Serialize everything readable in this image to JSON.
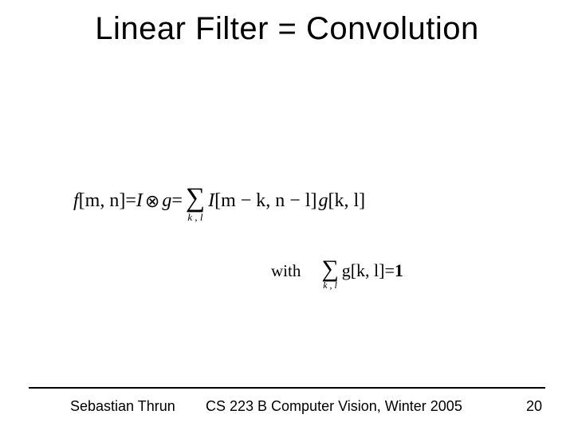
{
  "title": "Linear Filter = Convolution",
  "equation_main": {
    "lhs_f": "f",
    "lhs_args": "[m, n]",
    "eq1": " = ",
    "I": "I",
    "otimes": "⊗",
    "g": "g",
    "eq2": " = ",
    "sigma": "∑",
    "sum_sub": "k , l",
    "I2": "I",
    "Iargs": "[m − k, n − l]",
    "g2": "g",
    "gargs": "[k, l]"
  },
  "equation_secondary": {
    "with": "with",
    "sigma": "∑",
    "sum_sub": "k , l",
    "g": "g",
    "gargs": "[k, l]",
    "eq": " = ",
    "one": "1"
  },
  "footer": {
    "author": "Sebastian Thrun",
    "course": "CS 223 B Computer Vision, Winter 2005",
    "page": "20"
  }
}
